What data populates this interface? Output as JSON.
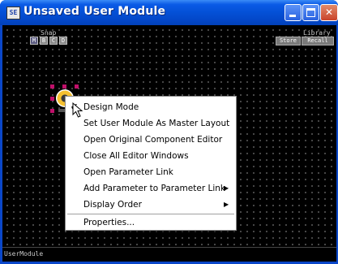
{
  "window": {
    "title": "Unsaved User Module",
    "app_icon_text": "SE"
  },
  "toolbar": {
    "snap_label": "Snap",
    "snap_buttons": [
      "M",
      "B",
      "C",
      "D"
    ],
    "library_label": "Library",
    "store_label": "Store",
    "recall_label": "Recall"
  },
  "component": {
    "type": "knob-icon"
  },
  "context_menu": {
    "items": [
      {
        "label": "Design Mode",
        "checked": true,
        "submenu": false
      },
      {
        "label": "Set User Module As Master Layout",
        "checked": false,
        "submenu": false
      },
      {
        "label": "Open Original Component Editor",
        "checked": false,
        "submenu": false
      },
      {
        "label": "Close All Editor Windows",
        "checked": false,
        "submenu": false
      },
      {
        "label": "Open Parameter Link",
        "checked": false,
        "submenu": false
      },
      {
        "label": "Add Parameter to Parameter Link",
        "checked": false,
        "submenu": true
      },
      {
        "label": "Display Order",
        "checked": false,
        "submenu": true
      },
      {
        "label": "Properties...",
        "checked": false,
        "submenu": false
      }
    ],
    "check_glyph": "✔",
    "submenu_glyph": "▶"
  },
  "statusbar": {
    "text": "UserModule"
  },
  "colors": {
    "titlebar": "#0450d6",
    "canvas": "#000000",
    "grid_dot": "#5a5a5a",
    "knob_accent": "#f5c030",
    "handle": "#c0106a"
  }
}
